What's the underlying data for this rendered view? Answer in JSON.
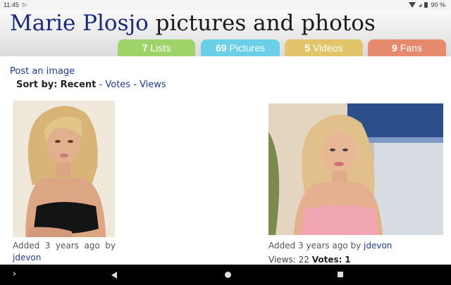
{
  "status_bar": {
    "time": "11:45",
    "battery": "90 %"
  },
  "header": {
    "title_name": "Marie Plosjo",
    "title_rest": "pictures and photos"
  },
  "tabs": [
    {
      "count": "7",
      "label": "Lists",
      "color": "#9fd36a"
    },
    {
      "count": "69",
      "label": "Pictures",
      "color": "#6ccfe8"
    },
    {
      "count": "5",
      "label": "Videos",
      "color": "#e2c56a"
    },
    {
      "count": "9",
      "label": "Fans",
      "color": "#e58a6c"
    }
  ],
  "post_link": "Post an image",
  "sort": {
    "label": "Sort by:",
    "current": "Recent",
    "sep1": " - ",
    "votes": "Votes",
    "sep2": " - ",
    "views": "Views"
  },
  "photos": [
    {
      "added_words": [
        "Added",
        "3",
        "years",
        "ago",
        "by"
      ],
      "user": "jdevon"
    },
    {
      "added": "Added 3 years ago by",
      "user": "jdevon",
      "views_label": "Views:",
      "views": "22",
      "votes_label": "Votes:",
      "votes": "1"
    }
  ],
  "colors": {
    "link": "#1f3a8a",
    "title_name": "#1a2a7a"
  }
}
